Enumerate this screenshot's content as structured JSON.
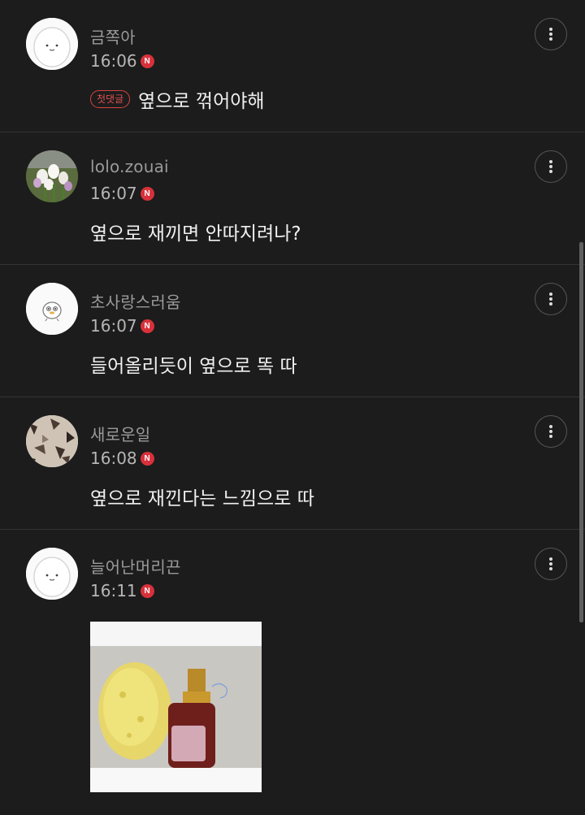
{
  "comments": [
    {
      "author": "금쪽아",
      "time": "16:06",
      "new_badge": "N",
      "first_comment_badge": "첫댓글",
      "text": "옆으로 꺾어야해"
    },
    {
      "author": "lolo.zouai",
      "time": "16:07",
      "new_badge": "N",
      "text": "옆으로 재끼면 안따지려나?"
    },
    {
      "author": "초사랑스러움",
      "time": "16:07",
      "new_badge": "N",
      "text": "들어올리듯이 옆으로 똑 따"
    },
    {
      "author": "새로운일",
      "time": "16:08",
      "new_badge": "N",
      "text": "옆으로 재낀다는 느낌으로 따"
    },
    {
      "author": "늘어난머리끈",
      "time": "16:11",
      "new_badge": "N"
    }
  ],
  "icons": {
    "more": "more-vertical-icon",
    "new": "new-n-badge"
  },
  "colors": {
    "background": "#1c1c1c",
    "new_badge": "#d8313b",
    "first_badge": "#d94242"
  }
}
